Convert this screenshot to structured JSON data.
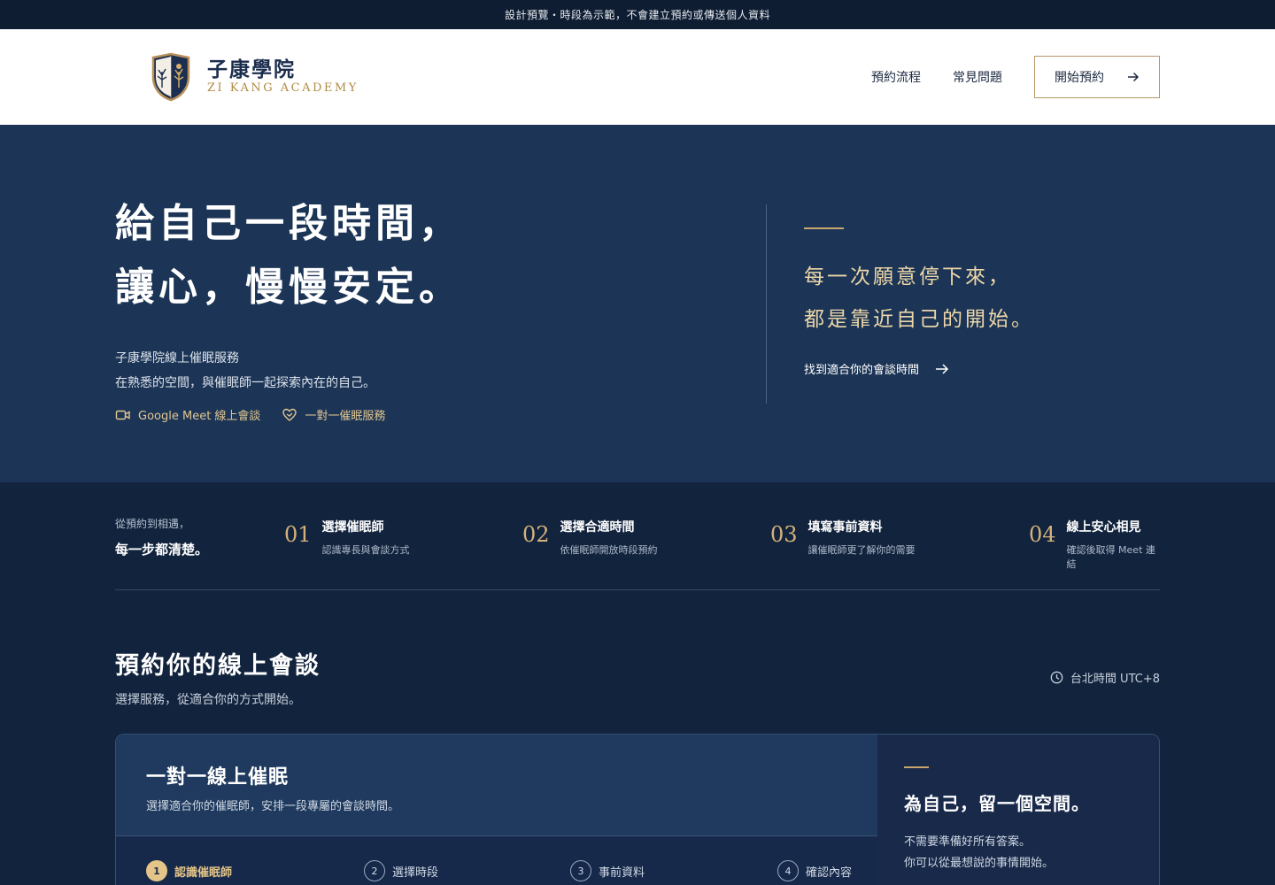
{
  "notice": "設計預覽・時段為示範，不會建立預約或傳送個人資料",
  "brand": {
    "name_cn": "子康學院",
    "name_en": "ZI KANG ACADEMY"
  },
  "nav": {
    "link1": "預約流程",
    "link2": "常見問題",
    "cta": "開始預約"
  },
  "hero": {
    "title_line1": "給自己一段時間，",
    "title_line2": "讓心，慢慢安定。",
    "sub_line1": "子康學院線上催眠服務",
    "sub_line2": "在熟悉的空間，與催眠師一起探索內在的自己。",
    "tag1": "Google Meet 線上會談",
    "tag2": "一對一催眠服務",
    "quote_line1": "每一次願意停下來，",
    "quote_line2": "都是靠近自己的開始。",
    "quote_link": "找到適合你的會談時間"
  },
  "steps": {
    "intro_line1": "從預約到相遇，",
    "intro_line2": "每一步都清楚。",
    "items": [
      {
        "num": "01",
        "title": "選擇催眠師",
        "desc": "認識專長與會談方式"
      },
      {
        "num": "02",
        "title": "選擇合適時間",
        "desc": "依催眠師開放時段預約"
      },
      {
        "num": "03",
        "title": "填寫事前資料",
        "desc": "讓催眠師更了解你的需要"
      },
      {
        "num": "04",
        "title": "線上安心相見",
        "desc": "確認後取得 Meet 連結"
      }
    ]
  },
  "booking": {
    "title": "預約你的線上會談",
    "subtitle": "選擇服務，從適合你的方式開始。",
    "timezone": "台北時間 UTC+8",
    "card": {
      "title": "一對一線上催眠",
      "desc": "選擇適合你的催眠師，安排一段專屬的會談時間。",
      "wizard": [
        {
          "num": "1",
          "label": "認識催眠師"
        },
        {
          "num": "2",
          "label": "選擇時段"
        },
        {
          "num": "3",
          "label": "事前資料"
        },
        {
          "num": "4",
          "label": "確認內容"
        }
      ]
    },
    "aside": {
      "title": "為自己，留一個空間。",
      "line1": "不需要準備好所有答案。",
      "line2": "你可以從最想說的事情開始。"
    }
  },
  "colors": {
    "navy": "#1c3556",
    "deep_navy": "#12233d",
    "gold": "#c9a76b",
    "white": "#ffffff"
  }
}
